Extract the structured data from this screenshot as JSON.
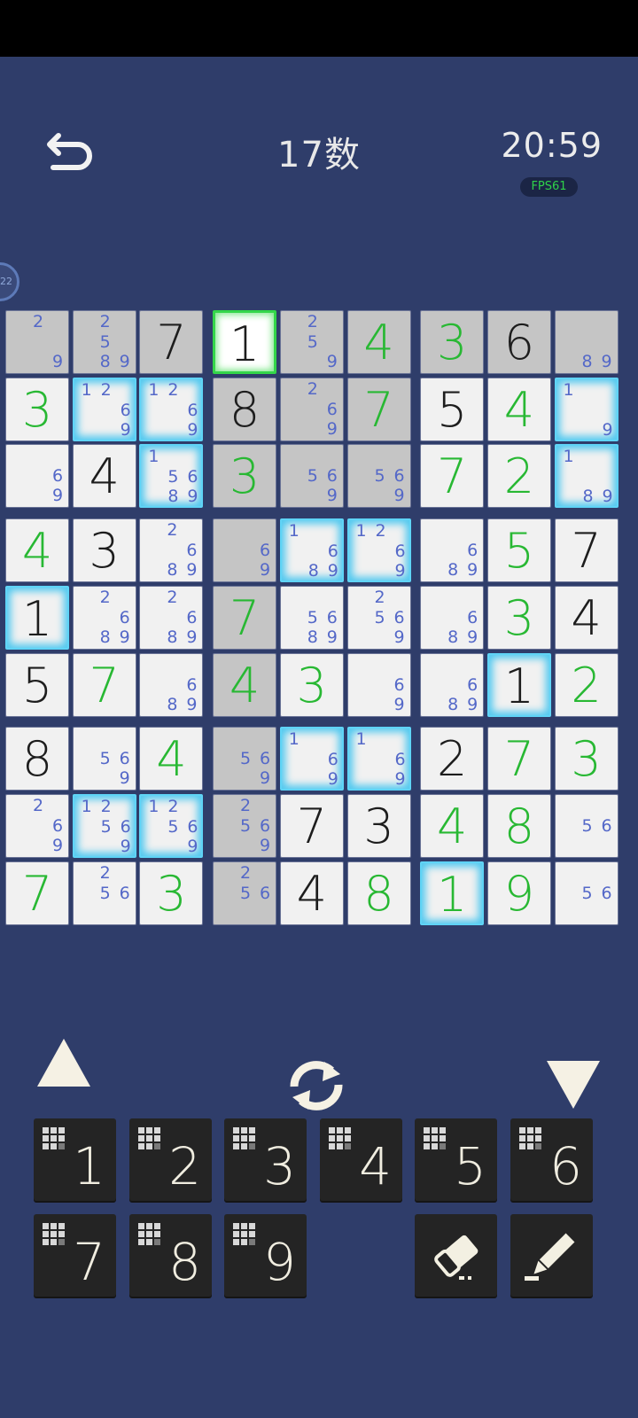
{
  "header": {
    "title": "17数",
    "timer": "20:59",
    "fps": "FPS61",
    "side_badge": "22"
  },
  "board": {
    "cells": [
      [
        {
          "n": "2,9",
          "shade": true
        },
        {
          "n": "2,5,8,9",
          "shade": true
        },
        {
          "v": "7",
          "given": true,
          "shade": true
        },
        {
          "v": "1",
          "given": true,
          "selected": true
        },
        {
          "n": "2,5,9",
          "shade": true
        },
        {
          "v": "4",
          "shade": true
        },
        {
          "v": "3",
          "shade": true
        },
        {
          "v": "6",
          "given": true,
          "shade": true
        },
        {
          "n": "8,9",
          "shade": true
        }
      ],
      [
        {
          "v": "3"
        },
        {
          "n": "1,2,6,9",
          "glow": true
        },
        {
          "n": "1,2,6,9",
          "glow": true
        },
        {
          "v": "8",
          "given": true,
          "shade": true
        },
        {
          "n": "2,6,9",
          "shade": true
        },
        {
          "v": "7",
          "shade": true
        },
        {
          "v": "5",
          "given": true
        },
        {
          "v": "4"
        },
        {
          "n": "1,9",
          "glow": true
        }
      ],
      [
        {
          "n": "6,9"
        },
        {
          "v": "4",
          "given": true
        },
        {
          "n": "1,5,6,8,9",
          "glow": true
        },
        {
          "v": "3",
          "shade": true
        },
        {
          "n": "5,6,9",
          "shade": true
        },
        {
          "n": "5,6,9",
          "shade": true
        },
        {
          "v": "7"
        },
        {
          "v": "2"
        },
        {
          "n": "1,8,9",
          "glow": true
        }
      ],
      [
        {
          "v": "4"
        },
        {
          "v": "3",
          "given": true
        },
        {
          "n": "2,6,8,9"
        },
        {
          "n": "6,9",
          "shade": true
        },
        {
          "n": "1,6,8,9",
          "glow": true
        },
        {
          "n": "1,2,6,9",
          "glow": true
        },
        {
          "n": "6,8,9"
        },
        {
          "v": "5"
        },
        {
          "v": "7",
          "given": true
        }
      ],
      [
        {
          "v": "1",
          "given": true,
          "glow": true
        },
        {
          "n": "2,6,8,9"
        },
        {
          "n": "2,6,8,9"
        },
        {
          "v": "7",
          "shade": true
        },
        {
          "n": "5,6,8,9"
        },
        {
          "n": "2,5,6,9"
        },
        {
          "n": "6,8,9"
        },
        {
          "v": "3"
        },
        {
          "v": "4",
          "given": true
        }
      ],
      [
        {
          "v": "5",
          "given": true
        },
        {
          "v": "7"
        },
        {
          "n": "6,8,9"
        },
        {
          "v": "4",
          "shade": true
        },
        {
          "v": "3"
        },
        {
          "n": "6,9"
        },
        {
          "n": "6,8,9"
        },
        {
          "v": "1",
          "given": true,
          "glow": true
        },
        {
          "v": "2"
        }
      ],
      [
        {
          "v": "8",
          "given": true
        },
        {
          "n": "5,6,9"
        },
        {
          "v": "4"
        },
        {
          "n": "5,6,9",
          "shade": true
        },
        {
          "n": "1,6,9",
          "glow": true
        },
        {
          "n": "1,6,9",
          "glow": true
        },
        {
          "v": "2",
          "given": true
        },
        {
          "v": "7"
        },
        {
          "v": "3"
        }
      ],
      [
        {
          "n": "2,6,9"
        },
        {
          "n": "1,2,5,6,9",
          "glow": true
        },
        {
          "n": "1,2,5,6,9",
          "glow": true
        },
        {
          "n": "2,5,6,9",
          "shade": true
        },
        {
          "v": "7",
          "given": true
        },
        {
          "v": "3",
          "given": true
        },
        {
          "v": "4"
        },
        {
          "v": "8"
        },
        {
          "n": "5,6"
        }
      ],
      [
        {
          "v": "7"
        },
        {
          "n": "2,5,6"
        },
        {
          "v": "3"
        },
        {
          "n": "2,5,6",
          "shade": true
        },
        {
          "v": "4",
          "given": true
        },
        {
          "v": "8"
        },
        {
          "v": "1",
          "glow": true
        },
        {
          "v": "9"
        },
        {
          "n": "5,6"
        }
      ]
    ]
  },
  "controls": {
    "up_icon": "triangle-up-icon",
    "refresh_icon": "refresh-icon",
    "down_icon": "triangle-down-icon"
  },
  "keypad": {
    "digits": [
      "1",
      "2",
      "3",
      "4",
      "5",
      "6",
      "7",
      "8",
      "9"
    ],
    "eraser_icon": "eraser-icon",
    "pencil_icon": "pencil-icon"
  },
  "colors": {
    "background": "#2f3d6a",
    "given": "#1d1d1d",
    "user": "#28b833",
    "note": "#5468c8",
    "highlight": "#4fc8ef",
    "selected": "#34d64a"
  }
}
